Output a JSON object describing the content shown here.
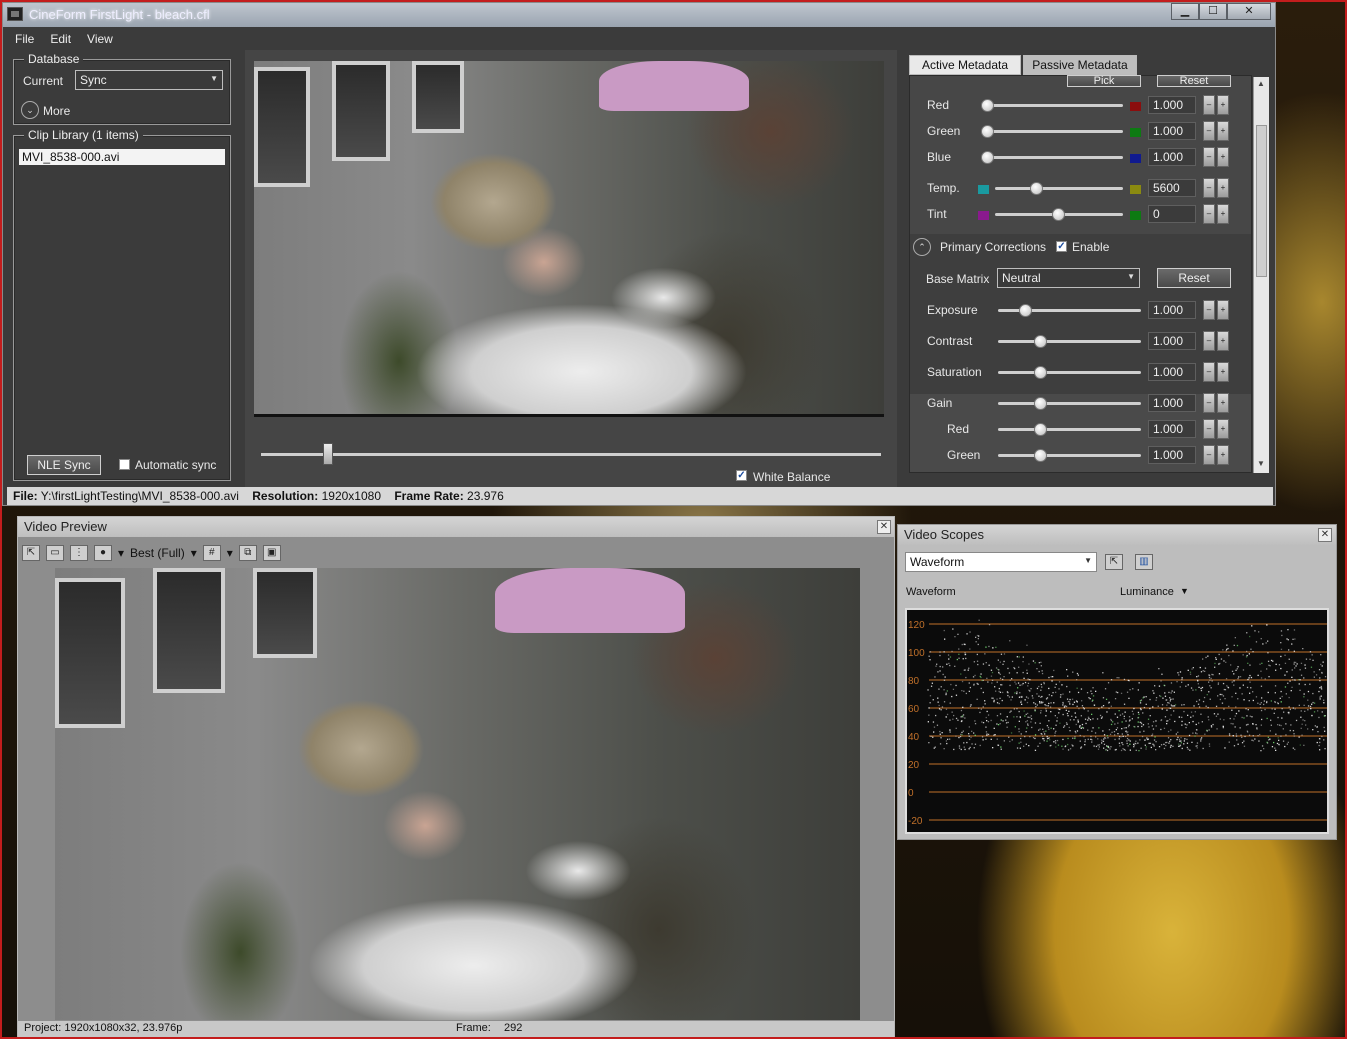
{
  "window": {
    "title": "CineForm FirstLight - bleach.cfl",
    "buttons": {
      "minimize": "▁",
      "maximize": "☐",
      "close": "✕"
    }
  },
  "menu": [
    "File",
    "Edit",
    "View"
  ],
  "database": {
    "legend": "Database",
    "current_label": "Current",
    "current_value": "Sync",
    "more_label": "More"
  },
  "clip_library": {
    "legend": "Clip Library (1 items)",
    "items": [
      "MVI_8538-000.avi"
    ],
    "nle_sync": "NLE Sync",
    "automatic_sync": "Automatic sync"
  },
  "viewer": {
    "timeline_position": 0.11,
    "white_balance_label": "White  Balance",
    "white_balance_checked": true
  },
  "metadata": {
    "tabs": [
      "Active Metadata",
      "Passive Metadata"
    ],
    "pick": "Pick",
    "reset_top": "Reset",
    "white_balance_rows": [
      {
        "label": "Red",
        "value": "1.000",
        "swatch": "#8b0d0d",
        "pos": 0.0
      },
      {
        "label": "Green",
        "value": "1.000",
        "swatch": "#0d7a12",
        "pos": 0.0
      },
      {
        "label": "Blue",
        "value": "1.000",
        "swatch": "#101a8f",
        "pos": 0.0
      },
      {
        "label": "Temp.",
        "value": "5600",
        "left_swatch": "#1a9aa0",
        "swatch": "#8a8a10",
        "pos": 0.31
      },
      {
        "label": "Tint",
        "value": "0",
        "left_swatch": "#8a1a8e",
        "swatch": "#0d7a12",
        "pos": 0.5
      }
    ],
    "primary": {
      "label": "Primary Corrections",
      "enable_label": "Enable",
      "enabled": true,
      "base_matrix_label": "Base Matrix",
      "base_matrix_value": "Neutral",
      "reset": "Reset"
    },
    "primary_rows": [
      {
        "label": "Exposure",
        "value": "1.000",
        "pos": 0.16
      },
      {
        "label": "Contrast",
        "value": "1.000",
        "pos": 0.27
      },
      {
        "label": "Saturation",
        "value": "1.000",
        "pos": 0.27
      },
      {
        "label": "Gain",
        "value": "1.000",
        "pos": 0.27
      },
      {
        "label": "Red",
        "value": "1.000",
        "pos": 0.27
      },
      {
        "label": "Green",
        "value": "1.000",
        "pos": 0.27
      }
    ]
  },
  "status": {
    "file_label": "File:",
    "file_value": "Y:\\firstLightTesting\\MVI_8538-000.avi",
    "resolution_label": "Resolution:",
    "resolution_value": "1920x1080",
    "frame_rate_label": "Frame Rate:",
    "frame_rate_value": "23.976"
  },
  "preview": {
    "title": "Video Preview",
    "quality": "Best (Full)",
    "project_label": "Project:",
    "project_value": "1920x1080x32, 23.976p",
    "frame_label": "Frame:",
    "frame_value": "292"
  },
  "scopes": {
    "title": "Video Scopes",
    "scope_type": "Waveform",
    "plot_title": "Waveform",
    "channel": "Luminance",
    "axis_labels": [
      "120",
      "100",
      "80",
      "60",
      "40",
      "20",
      "0",
      "-20"
    ]
  },
  "colors": {
    "accent_red": "#c31d1d",
    "panel": "#3b3b3b",
    "grid_line": "#c0702a"
  }
}
